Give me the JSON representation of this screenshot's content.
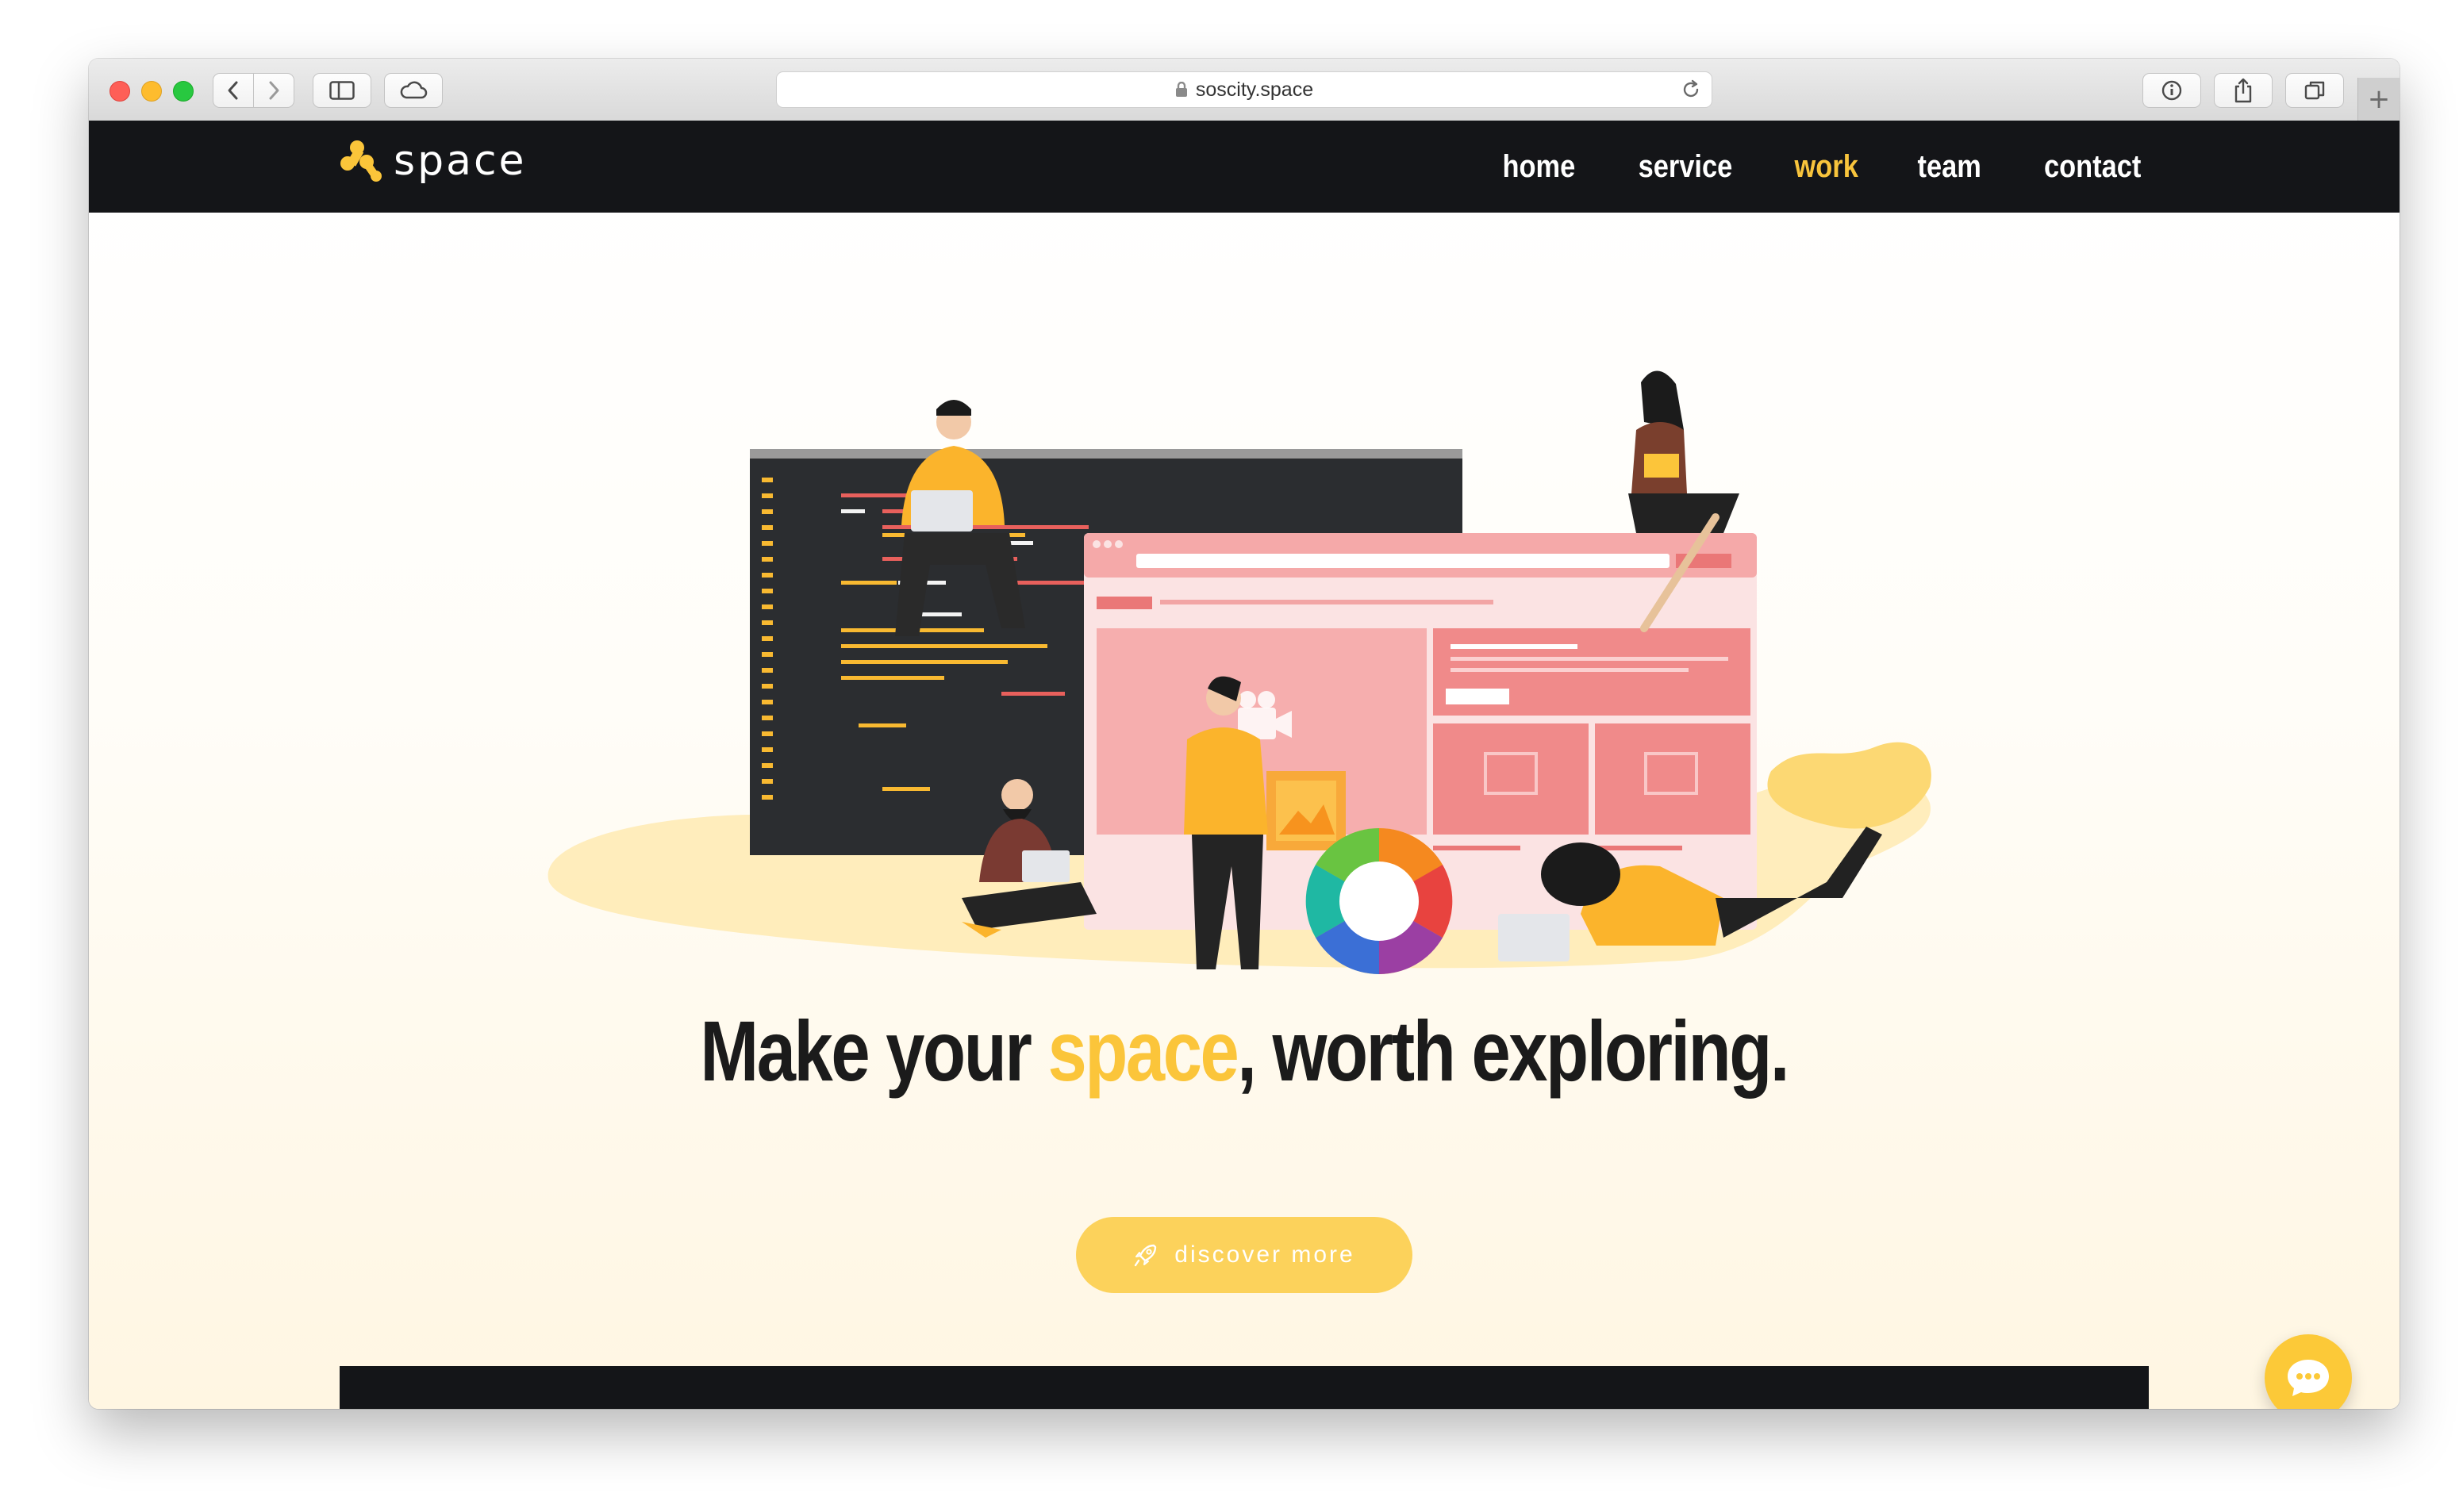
{
  "browser": {
    "url": "soscity.space",
    "new_tab_label": "+"
  },
  "site": {
    "logo_text": "space",
    "nav": [
      {
        "label": "home",
        "active": false
      },
      {
        "label": "service",
        "active": false
      },
      {
        "label": "work",
        "active": true
      },
      {
        "label": "team",
        "active": false
      },
      {
        "label": "contact",
        "active": false
      }
    ],
    "headline": {
      "before": "Make your ",
      "highlight": "space",
      "after": ", worth exploring."
    },
    "cta_label": "discover more",
    "cta_icon": "rocket-icon",
    "chat_icon": "chat-bubble-icon"
  },
  "colors": {
    "nav_bg": "#141518",
    "accent": "#fbc53a",
    "cta_bg": "#fcd25b"
  }
}
